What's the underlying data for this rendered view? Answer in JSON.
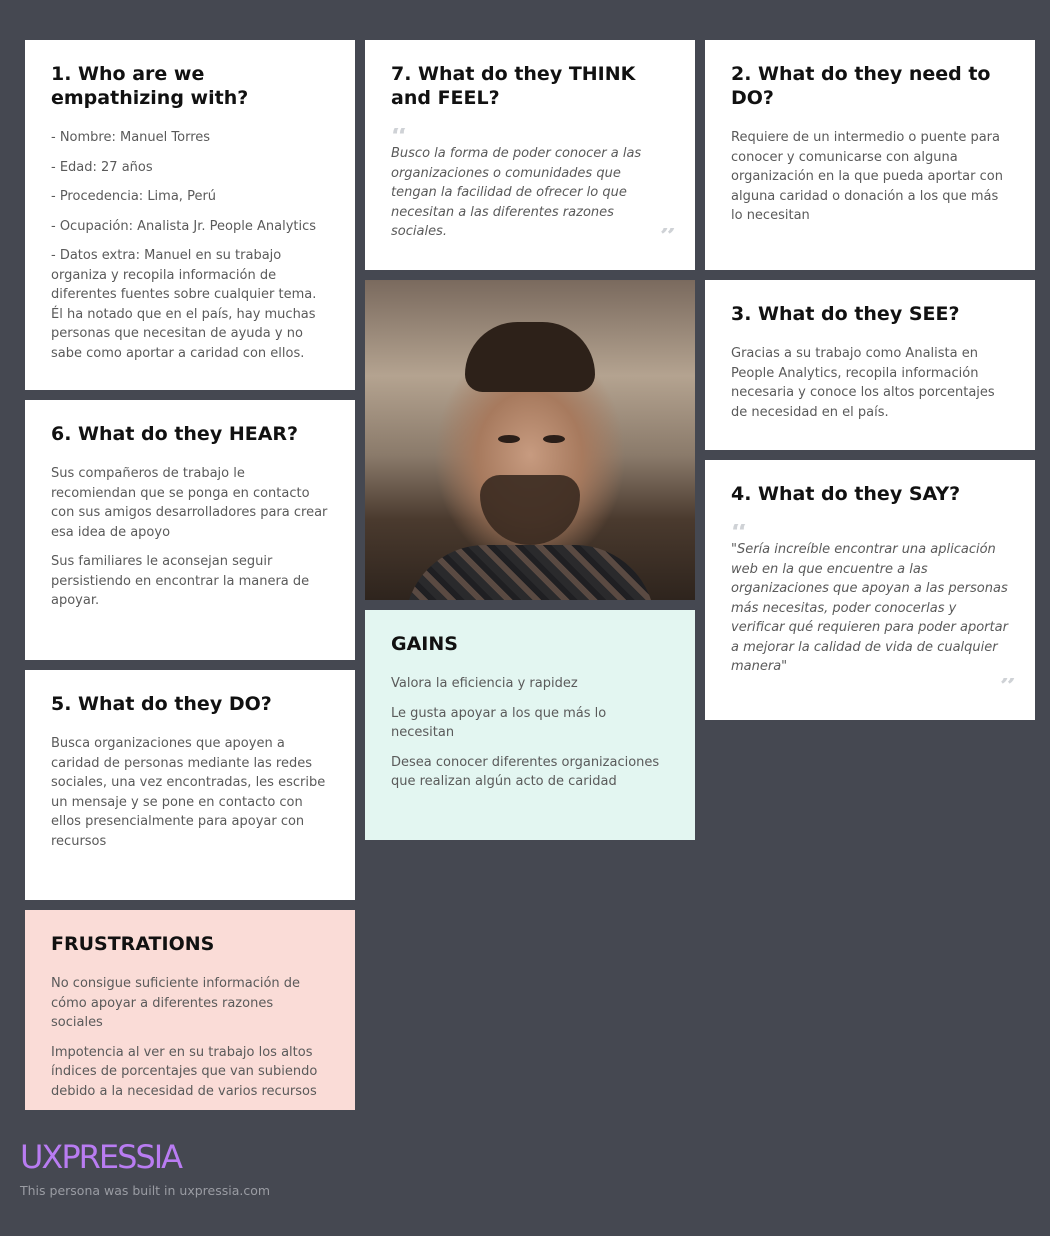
{
  "who": {
    "title": "1. Who are we empathizing with?",
    "items": [
      "- Nombre: Manuel Torres",
      "- Edad: 27 años",
      "- Procedencia: Lima, Perú",
      "- Ocupación: Analista Jr. People Analytics",
      "- Datos extra: Manuel en su trabajo organiza y recopila información de diferentes fuentes sobre cualquier tema. Él ha notado que en el país, hay muchas personas que necesitan de ayuda y no sabe como aportar a caridad con ellos."
    ]
  },
  "think": {
    "title": "7. What do they THINK and FEEL?",
    "quote": "Busco la forma de poder conocer a las organizaciones o comunidades que tengan la facilidad de ofrecer lo que necesitan a las diferentes razones sociales."
  },
  "need": {
    "title": "2. What do they need to DO?",
    "text": "Requiere de un intermedio o puente para conocer y comunicarse con alguna organización en la que pueda aportar con alguna caridad o donación a los que más lo necesitan"
  },
  "see": {
    "title": "3. What do they SEE?",
    "text": "Gracias a su trabajo como Analista en People Analytics, recopila información necesaria y conoce los altos porcentajes de necesidad en el país."
  },
  "hear": {
    "title": "6. What do they HEAR?",
    "items": [
      "Sus compañeros de trabajo le recomiendan que se ponga en contacto con sus amigos desarrolladores para crear esa idea de apoyo",
      "Sus familiares le aconsejan seguir persistiendo en encontrar la manera de apoyar."
    ]
  },
  "say": {
    "title": "4. What do they SAY?",
    "quote": "\"Sería increíble encontrar una aplicación web en la que encuentre a las organizaciones que apoyan a las personas más necesitas, poder conocerlas y verificar qué requieren para poder aportar a mejorar la calidad de vida de cualquier manera\""
  },
  "do": {
    "title": "5. What do they DO?",
    "text": "Busca organizaciones que apoyen a caridad de personas mediante las redes sociales, una vez encontradas, les escribe un mensaje y se pone en contacto con ellos presencialmente para apoyar con recursos"
  },
  "gains": {
    "title": "GAINS",
    "items": [
      "Valora la eficiencia y rapidez",
      "Le gusta apoyar a los que más lo necesitan",
      "Desea conocer diferentes organizaciones que realizan algún acto de caridad"
    ]
  },
  "frustrations": {
    "title": "FRUSTRATIONS",
    "items": [
      "No consigue suficiente información de cómo apoyar a diferentes razones sociales",
      "Impotencia al ver en su trabajo los altos índices de porcentajes que van subiendo debido a la necesidad de varios recursos"
    ]
  },
  "footer": {
    "brand": "UXPRESSIA",
    "note": "This persona was built in uxpressia.com"
  },
  "colors": {
    "background": "#454851",
    "gains": "#e3f6f1",
    "frustrations": "#fadcd7",
    "brand": "#b97cf2"
  }
}
